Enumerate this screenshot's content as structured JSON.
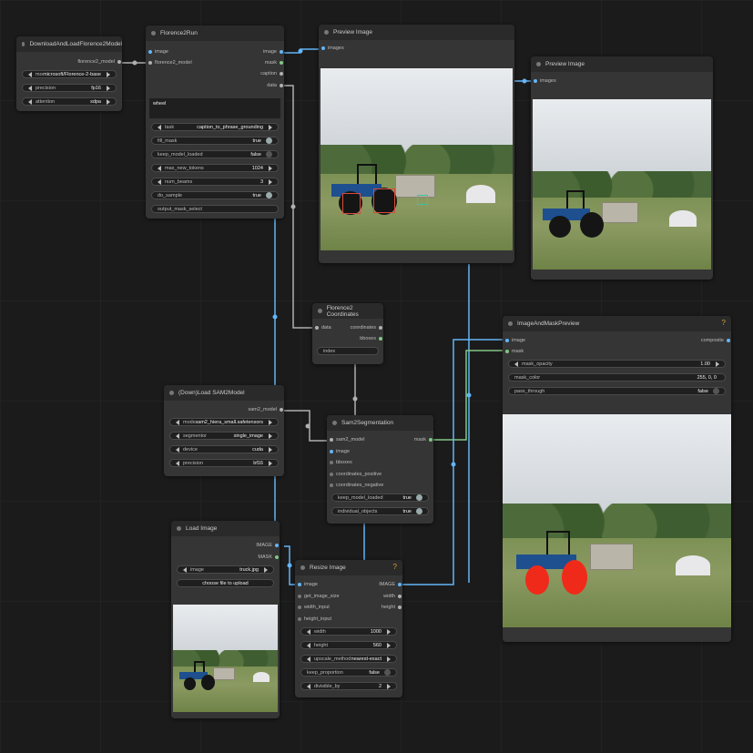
{
  "colors": {
    "image_wire": "#64b5f6",
    "mask_wire": "#81c784",
    "model_wire": "#b0b0b0",
    "canvas": "#1b1b1b",
    "node": "#353535",
    "accent": "#d8a23a",
    "overlay_box": "#d84a3a"
  },
  "nodes": {
    "dlflorence": {
      "title": "DownloadAndLoadFlorence2Model",
      "out": "florence2_model",
      "widgets": [
        {
          "label": "model",
          "value": "microsoft/Florence-2-base"
        },
        {
          "label": "precision",
          "value": "fp16"
        },
        {
          "label": "attention",
          "value": "sdpa"
        }
      ]
    },
    "florence2run": {
      "title": "Florence2Run",
      "inputs": [
        "image",
        "florence2_model"
      ],
      "outputs": [
        "image",
        "mask",
        "caption",
        "data"
      ],
      "text": "wheel",
      "widgets": [
        {
          "label": "task",
          "value": "caption_to_phrase_grounding"
        },
        {
          "label": "fill_mask",
          "value": "true"
        },
        {
          "label": "keep_model_loaded",
          "value": "false"
        },
        {
          "label": "max_new_tokens",
          "value": "1024"
        },
        {
          "label": "num_beams",
          "value": "3"
        },
        {
          "label": "do_sample",
          "value": "true"
        },
        {
          "label": "output_mask_select",
          "value": ""
        }
      ]
    },
    "preview1": {
      "title": "Preview Image",
      "input": "images"
    },
    "preview2": {
      "title": "Preview Image",
      "input": "images"
    },
    "coords": {
      "title": "Florence2 Coordinates",
      "input": "data",
      "outputs": [
        "coordinates",
        "bboxes"
      ],
      "index_label": "index"
    },
    "sam2load": {
      "title": "(Down)Load SAM2Model",
      "out": "sam2_model",
      "widgets": [
        {
          "label": "model",
          "value": "sam2_hiera_small.safetensors"
        },
        {
          "label": "segmentor",
          "value": "single_image"
        },
        {
          "label": "device",
          "value": "cuda"
        },
        {
          "label": "precision",
          "value": "bf16"
        }
      ]
    },
    "sam2seg": {
      "title": "Sam2Segmentation",
      "inputs": [
        "sam2_model",
        "image",
        "bboxes",
        "coordinates_positive",
        "coordinates_negative"
      ],
      "out": "mask",
      "widgets": [
        {
          "label": "keep_model_loaded",
          "value": "true"
        },
        {
          "label": "individual_objects",
          "value": "true"
        }
      ]
    },
    "imgmask": {
      "title": "ImageAndMaskPreview",
      "inputs": [
        "image",
        "mask"
      ],
      "out": "composite",
      "help": "?",
      "widgets": [
        {
          "label": "mask_opacity",
          "value": "1.00"
        },
        {
          "label": "mask_color",
          "value": "255, 0, 0"
        },
        {
          "label": "pass_through",
          "value": "false"
        }
      ]
    },
    "loadimg": {
      "title": "Load Image",
      "outputs": [
        "IMAGE",
        "MASK"
      ],
      "widgets": [
        {
          "label": "image",
          "value": "truck.jpg"
        }
      ],
      "upload": "choose file to upload"
    },
    "resize": {
      "title": "Resize Image",
      "help": "?",
      "inputs": [
        "image",
        "get_image_size",
        "width_input",
        "height_input"
      ],
      "outputs": [
        "IMAGE",
        "width",
        "height"
      ],
      "widgets": [
        {
          "label": "width",
          "value": "1000"
        },
        {
          "label": "height",
          "value": "560"
        },
        {
          "label": "upscale_method",
          "value": "nearest-exact"
        },
        {
          "label": "keep_proportion",
          "value": "false"
        },
        {
          "label": "divisible_by",
          "value": "2"
        }
      ]
    }
  }
}
